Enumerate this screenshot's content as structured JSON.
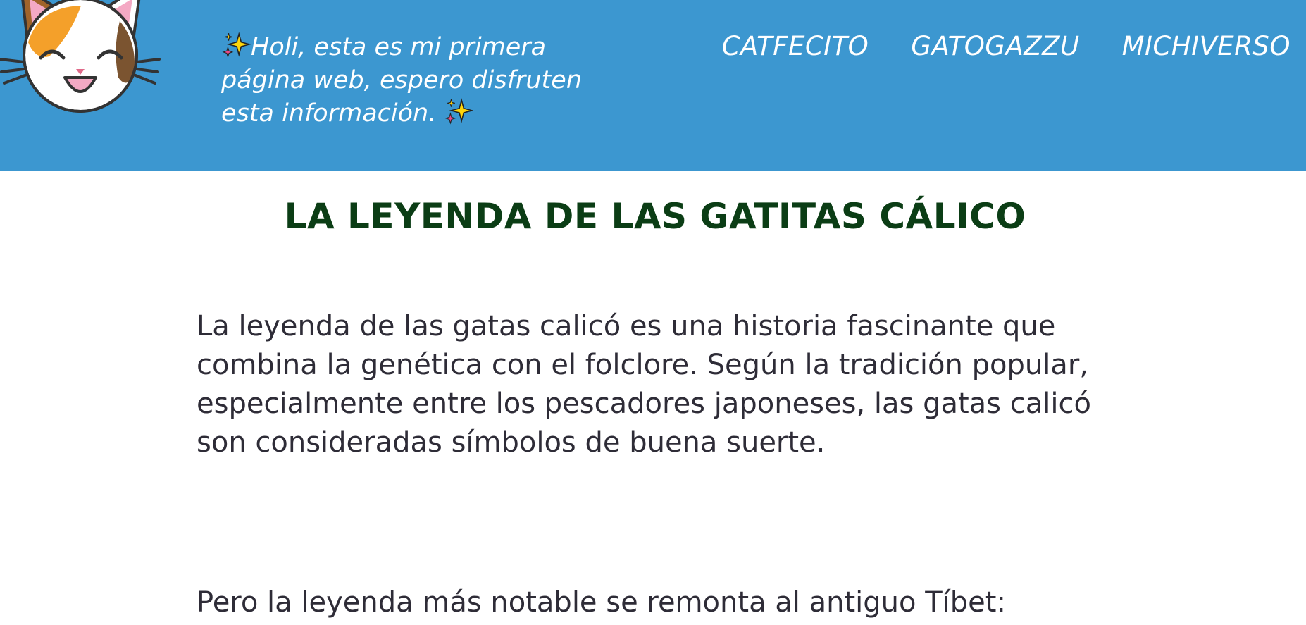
{
  "header": {
    "logo_icon": "calico-cat-face-logo",
    "tagline": "Holi, esta es mi primera página web, espero disfruten esta información. ",
    "sparkle_icon": "sparkles-emoji",
    "colors": {
      "background": "#3c97d0",
      "text": "#ffffff"
    }
  },
  "nav": {
    "items": [
      {
        "label": "CATFECITO"
      },
      {
        "label": "GATOGAZZU"
      },
      {
        "label": "MICHIVERSO"
      }
    ]
  },
  "main": {
    "title": "LA LEYENDA DE LAS GATITAS CÁLICO",
    "paragraphs": [
      "La leyenda de las gatas calicó es una historia fascinante que combina la genética con el folclore. Según la tradición popular, especialmente entre los pescadores japoneses, las gatas calicó son consideradas símbolos de buena suerte.",
      "Pero la leyenda más notable se remonta al antiguo Tíbet:"
    ],
    "colors": {
      "title": "#0b3d15",
      "text": "#2e2c37"
    }
  }
}
